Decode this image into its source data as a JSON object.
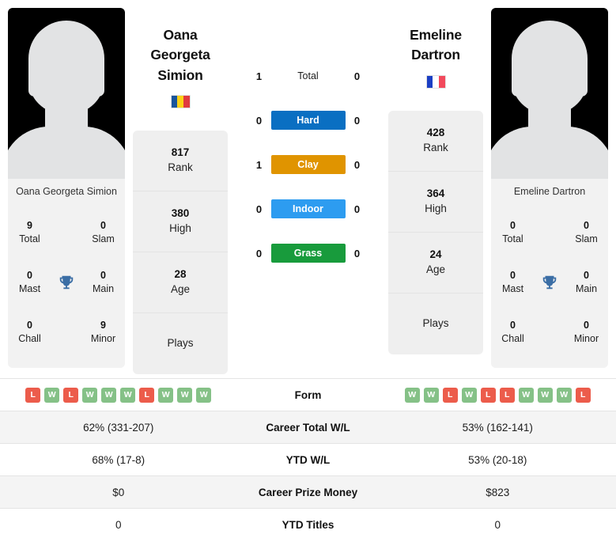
{
  "players": {
    "left": {
      "full_name": "Oana Georgeta Simion",
      "name_line1": "Oana Georgeta",
      "name_line2": "Simion",
      "photo_caption": "Oana Georgeta Simion",
      "flag": {
        "name": "romania-flag",
        "colors": [
          "#19559b",
          "#fcd116",
          "#e03a3e"
        ]
      },
      "info": [
        {
          "value": "817",
          "label": "Rank"
        },
        {
          "value": "380",
          "label": "High"
        },
        {
          "value": "28",
          "label": "Age"
        },
        {
          "value": "",
          "label": "Plays"
        }
      ],
      "titles": [
        {
          "value": "9",
          "label": "Total"
        },
        {
          "value": "0",
          "label": "Slam"
        },
        {
          "value": "0",
          "label": "Mast"
        },
        {
          "value": "0",
          "label": "Main"
        },
        {
          "value": "0",
          "label": "Chall"
        },
        {
          "value": "9",
          "label": "Minor"
        }
      ],
      "form": [
        "L",
        "W",
        "L",
        "W",
        "W",
        "W",
        "L",
        "W",
        "W",
        "W"
      ],
      "career_total_wl": "62% (331-207)",
      "ytd_wl": "68% (17-8)",
      "career_prize_money": "$0",
      "ytd_titles": "0"
    },
    "right": {
      "full_name": "Emeline Dartron",
      "name_line1": "Emeline",
      "name_line2": "Dartron",
      "photo_caption": "Emeline Dartron",
      "flag": {
        "name": "france-flag",
        "colors": [
          "#1b3fc4",
          "#ffffff",
          "#f2495c"
        ]
      },
      "info": [
        {
          "value": "428",
          "label": "Rank"
        },
        {
          "value": "364",
          "label": "High"
        },
        {
          "value": "24",
          "label": "Age"
        },
        {
          "value": "",
          "label": "Plays"
        }
      ],
      "titles": [
        {
          "value": "0",
          "label": "Total"
        },
        {
          "value": "0",
          "label": "Slam"
        },
        {
          "value": "0",
          "label": "Mast"
        },
        {
          "value": "0",
          "label": "Main"
        },
        {
          "value": "0",
          "label": "Chall"
        },
        {
          "value": "0",
          "label": "Minor"
        }
      ],
      "form": [
        "W",
        "W",
        "L",
        "W",
        "L",
        "L",
        "W",
        "W",
        "W",
        "L"
      ],
      "career_total_wl": "53% (162-141)",
      "ytd_wl": "53% (20-18)",
      "career_prize_money": "$823",
      "ytd_titles": "0"
    }
  },
  "head_to_head": [
    {
      "surface": "Total",
      "left": "1",
      "right": "0",
      "color": "none",
      "bar": false
    },
    {
      "surface": "Hard",
      "left": "0",
      "right": "0",
      "color": "#0a6fc2",
      "bar": true
    },
    {
      "surface": "Clay",
      "left": "1",
      "right": "0",
      "color": "#e09400",
      "bar": true
    },
    {
      "surface": "Indoor",
      "left": "0",
      "right": "0",
      "color": "#2d9cf0",
      "bar": true
    },
    {
      "surface": "Grass",
      "left": "0",
      "right": "0",
      "color": "#189b3c",
      "bar": true
    }
  ],
  "table": {
    "rows": [
      {
        "label": "Form",
        "type": "form"
      },
      {
        "label": "Career Total W/L",
        "type": "text",
        "key": "career_total_wl"
      },
      {
        "label": "YTD W/L",
        "type": "text",
        "key": "ytd_wl"
      },
      {
        "label": "Career Prize Money",
        "type": "text",
        "key": "career_prize_money"
      },
      {
        "label": "YTD Titles",
        "type": "text",
        "key": "ytd_titles"
      }
    ]
  },
  "icons": {
    "trophy": "trophy-icon",
    "trophy_color": "#3b6ea5"
  }
}
